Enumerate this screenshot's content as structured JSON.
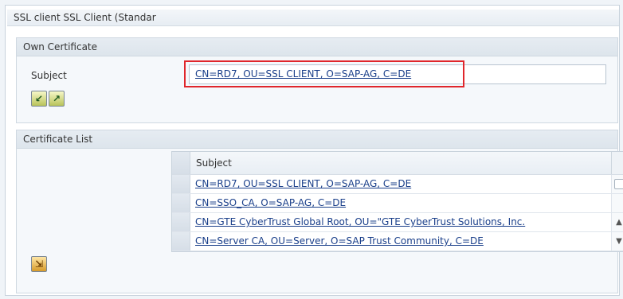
{
  "panel": {
    "title": "SSL client SSL Client (Standar"
  },
  "own_certificate": {
    "title": "Own Certificate",
    "subject_label": "Subject",
    "subject_value": "CN=RD7, OU=SSL CLIENT, O=SAP-AG, C=DE"
  },
  "certificate_list": {
    "title": "Certificate List",
    "column_header": "Subject",
    "rows": [
      "CN=RD7, OU=SSL CLIENT, O=SAP-AG, C=DE",
      "CN=SSO_CA, O=SAP-AG, C=DE",
      "CN=GTE CyberTrust Global Root, OU=\"GTE CyberTrust Solutions, Inc.",
      "CN=Server CA, OU=Server, O=SAP Trust Community, C=DE"
    ],
    "scroll_up": "▲",
    "scroll_down": "▼"
  },
  "icons": {
    "toolbar_1": "import-certificate-icon",
    "toolbar_2": "export-certificate-icon",
    "list_action": "add-to-list-icon"
  },
  "colors": {
    "highlight": "#e0262b",
    "link": "#1a3f8a"
  }
}
